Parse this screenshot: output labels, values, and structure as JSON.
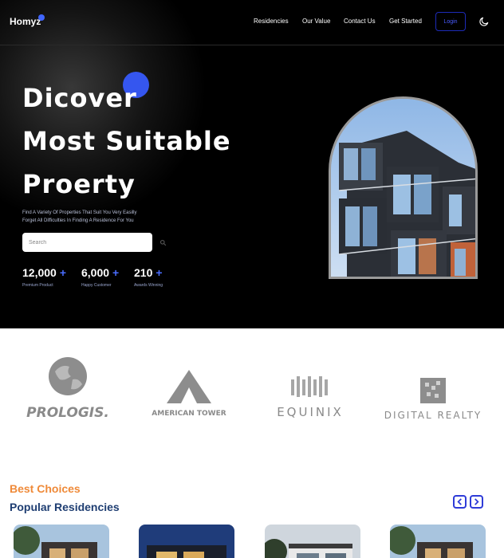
{
  "header": {
    "logo": "Homyz",
    "nav": [
      "Residencies",
      "Our Value",
      "Contact Us",
      "Get Started"
    ],
    "login": "Login",
    "theme_icon": "moon-icon"
  },
  "hero": {
    "title_lines": [
      "Dicover",
      "Most Suitable",
      "Proerty"
    ],
    "subtitle_lines": [
      "Find A Variety Of Properties That Suit You Very Easilly",
      "Forget All Difficulties In Finding A Residence For You"
    ],
    "search_placeholder": "Search",
    "stats": [
      {
        "value": "12,000",
        "plus": "+",
        "label": "Premium Product"
      },
      {
        "value": "6,000",
        "plus": "+",
        "label": "Happy Customer"
      },
      {
        "value": "210",
        "plus": "+",
        "label": "Awards Winning"
      }
    ]
  },
  "companies": [
    "PROLOGIS.",
    "AMERICAN TOWER",
    "EQUINIX",
    "DIGITAL REALTY"
  ],
  "residencies": {
    "eyebrow": "Best Choices",
    "heading": "Popular Residencies",
    "accent_color": "#ef8a39",
    "heading_color": "#1f3e72"
  },
  "colors": {
    "brand_blue": "#4066ff",
    "hero_bg": "#000000"
  }
}
